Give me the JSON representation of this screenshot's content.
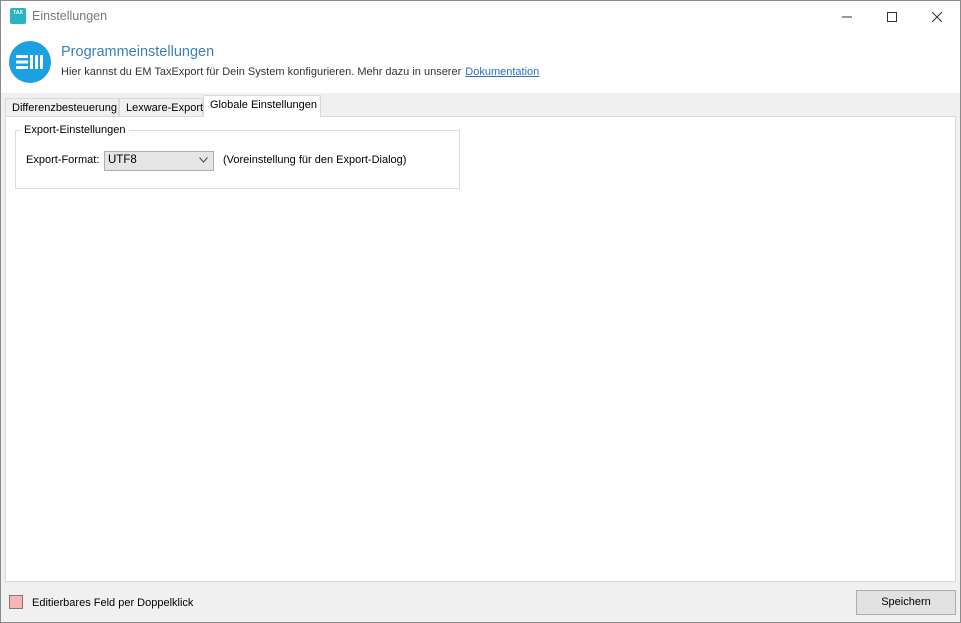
{
  "window": {
    "title": "Einstellungen",
    "app_icon_text": "TAX"
  },
  "header": {
    "title": "Programmeinstellungen",
    "subtitle": "Hier kannst du EM TaxExport für Dein System konfigurieren. Mehr dazu in unserer",
    "link_label": "Dokumentation",
    "logo_color": "#1ba1e2"
  },
  "tabs": [
    {
      "label": "Differenzbesteuerung",
      "active": false
    },
    {
      "label": "Lexware-Export",
      "active": false
    },
    {
      "label": "Globale Einstellungen",
      "active": true
    }
  ],
  "export_settings": {
    "group_title": "Export-Einstellungen",
    "format_label": "Export-Format:",
    "format_value": "UTF8",
    "format_hint": "(Voreinstellung für den Export-Dialog)"
  },
  "footer": {
    "legend_text": "Editierbares Feld per Doppelklick",
    "legend_color": "#f4b5b5",
    "save_label": "Speichern"
  }
}
